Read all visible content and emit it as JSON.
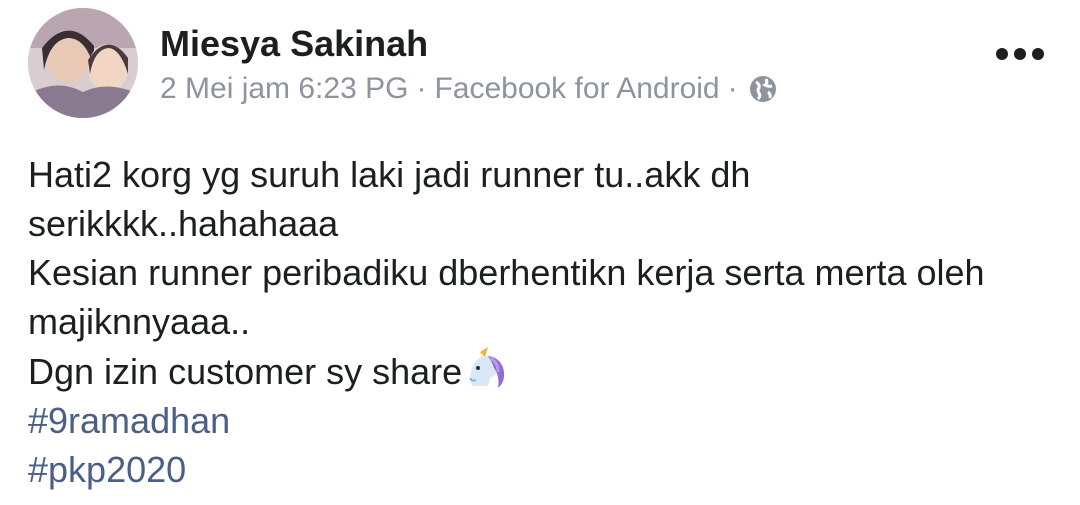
{
  "post": {
    "author": "Miesya Sakinah",
    "date": "2 Mei jam 6:23 PG",
    "separator": "·",
    "source": "Facebook for Android",
    "privacy_icon": "globe-icon",
    "more_icon": "more-options-icon",
    "body_lines": [
      "Hati2 korg yg suruh laki jadi runner tu..akk dh",
      "serikkkk..hahahaaa",
      "Kesian runner peribadiku dberhentikn kerja serta merta oleh",
      "majiknnyaaa..",
      "Dgn izin customer sy share"
    ],
    "emoji": "unicorn-emoji",
    "hashtags": [
      "#9ramadhan",
      "#pkp2020"
    ]
  },
  "colors": {
    "text": "#1c1e21",
    "meta": "#8d949e",
    "hashtag": "#4b5f86"
  }
}
